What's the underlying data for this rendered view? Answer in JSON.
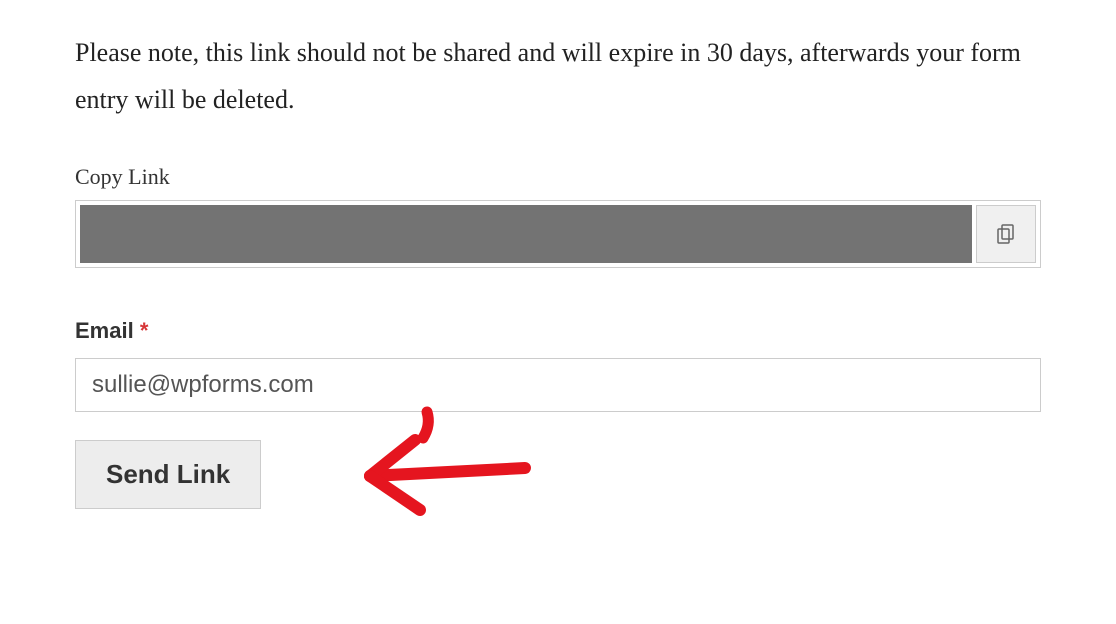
{
  "notice": "Please note, this link should not be shared and will expire in 30 days, afterwards your form entry will be deleted.",
  "copyLink": {
    "label": "Copy Link"
  },
  "email": {
    "label": "Email",
    "required": "*",
    "value": "sullie@wpforms.com"
  },
  "sendButton": {
    "label": "Send Link"
  }
}
